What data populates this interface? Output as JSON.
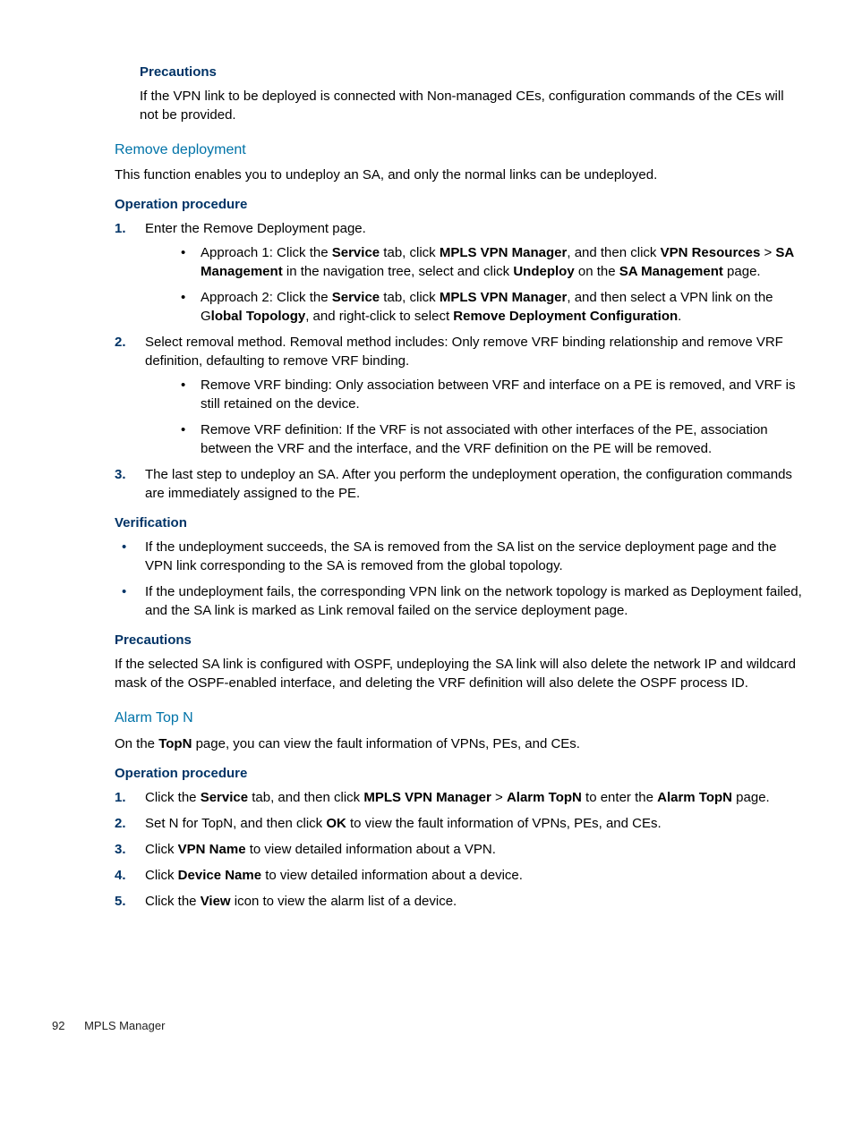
{
  "sec_precautions1": {
    "title": "Precautions",
    "text": "If the VPN link to be deployed is connected with Non-managed CEs, configuration commands of the CEs will not be provided."
  },
  "remove": {
    "title": "Remove deployment",
    "intro": "This function enables you to undeploy an SA, and only the normal links can be undeployed.",
    "op_title": "Operation procedure",
    "steps": {
      "s1": {
        "num": "1.",
        "text": "Enter the Remove Deployment page.",
        "a1_pre": "Approach 1: Click the ",
        "a1_b1": "Service",
        "a1_mid1": " tab, click ",
        "a1_b2": "MPLS VPN Manager",
        "a1_mid2": ", and then click ",
        "a1_b3": "VPN Resources",
        "a1_mid3": " > ",
        "a1_b4": "SA Management",
        "a1_mid4": " in the navigation tree, select and click ",
        "a1_b5": "Undeploy",
        "a1_mid5": " on the ",
        "a1_b6": "SA Management",
        "a1_end": " page.",
        "a2_pre": "Approach 2: Click the ",
        "a2_b1": "Service",
        "a2_mid1": " tab, click ",
        "a2_b2": "MPLS VPN Manager",
        "a2_mid2": ", and then select a VPN link on the G",
        "a2_b3": "lobal Topology",
        "a2_mid3": ", and right-click to select ",
        "a2_b4": "Remove Deployment Configuration",
        "a2_end": "."
      },
      "s2": {
        "num": "2.",
        "text": "Select removal method. Removal method includes: Only remove VRF binding relationship and remove VRF definition, defaulting to remove VRF binding.",
        "b1": "Remove VRF binding: Only association between VRF and interface on a PE is removed, and VRF is still retained on the device.",
        "b2": "Remove VRF definition: If the VRF is not associated with other interfaces of the PE, association between the VRF and the interface, and the VRF definition on the PE will be removed."
      },
      "s3": {
        "num": "3.",
        "text": "The last step to undeploy an SA. After you perform the undeployment operation, the configuration commands are immediately assigned to the PE."
      }
    },
    "verif_title": "Verification",
    "verif": {
      "v1": "If the undeployment succeeds, the SA is removed from the SA list on the service deployment page and the VPN link corresponding to the SA is removed from the global topology.",
      "v2": "If the undeployment fails, the corresponding VPN link on the network topology is marked as Deployment failed, and the SA link is marked as Link removal failed on the service deployment page."
    },
    "prec_title": "Precautions",
    "prec_text": "If the selected SA link is configured with OSPF, undeploying the SA link will also delete the network IP and wildcard mask of the OSPF-enabled interface, and deleting the VRF definition will also delete the OSPF process ID."
  },
  "alarm": {
    "title": "Alarm Top N",
    "intro_pre": "On the ",
    "intro_b": "TopN",
    "intro_post": " page, you can view the fault information of VPNs, PEs, and CEs.",
    "op_title": "Operation procedure",
    "s1": {
      "num": "1.",
      "pre": "Click the ",
      "b1": "Service",
      "m1": " tab, and then click ",
      "b2": "MPLS VPN Manager",
      "m2": " > ",
      "b3": "Alarm TopN",
      "m3": " to enter the ",
      "b4": "Alarm TopN",
      "end": " page."
    },
    "s2": {
      "num": "2.",
      "pre": "Set N for TopN, and then click ",
      "b1": "OK",
      "end": " to view the fault information of VPNs, PEs, and CEs."
    },
    "s3": {
      "num": "3.",
      "pre": "Click ",
      "b1": "VPN Name",
      "end": " to view detailed information about a VPN."
    },
    "s4": {
      "num": "4.",
      "pre": "Click ",
      "b1": "Device Name",
      "end": " to view detailed information about a device."
    },
    "s5": {
      "num": "5.",
      "pre": "Click the ",
      "b1": "View",
      "end": " icon to view the alarm list of a device."
    }
  },
  "footer": {
    "page": "92",
    "title": "MPLS Manager"
  }
}
